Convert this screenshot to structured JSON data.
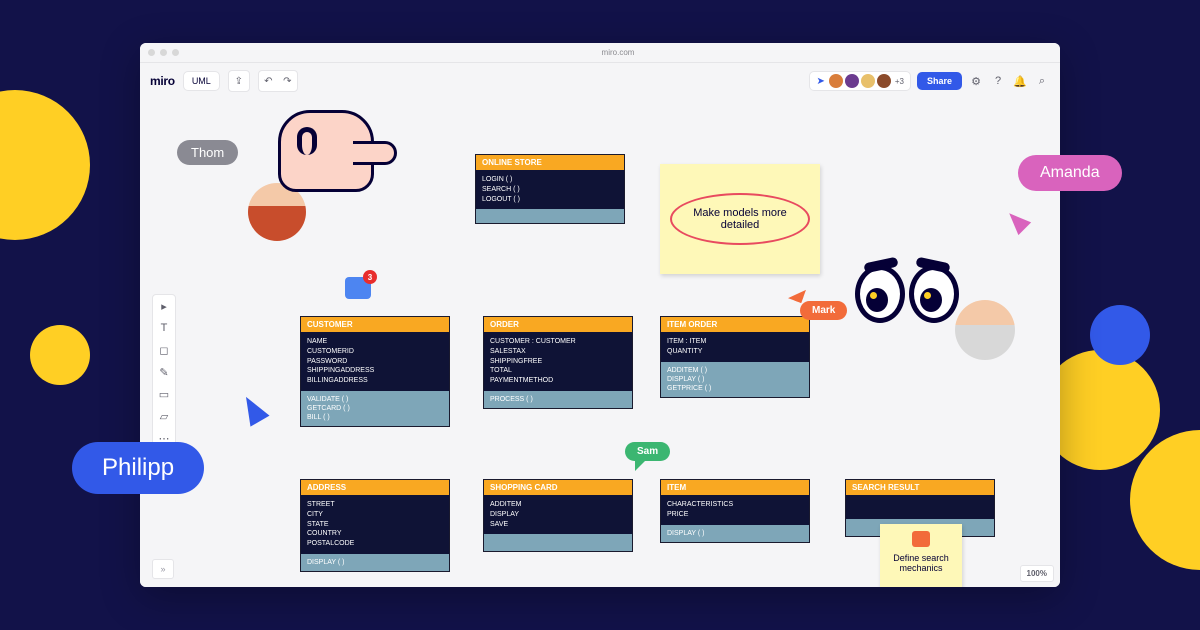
{
  "url": "miro.com",
  "logo": "miro",
  "doc_title": "UML",
  "zoom": "100%",
  "share_label": "Share",
  "presence_extra": "+3",
  "comment_count": "3",
  "cursors": {
    "thom": "Thom",
    "philipp": "Philipp",
    "amanda": "Amanda",
    "mark": "Mark",
    "sam": "Sam"
  },
  "stickies": {
    "models": "Make models more detailed",
    "search": "Define search mechanics"
  },
  "uml": {
    "online_store": {
      "title": "ONLINE STORE",
      "attrs": [
        "LOGIN ( )",
        "SEARCH ( )",
        "LOGOUT ( )"
      ],
      "ops": []
    },
    "customer": {
      "title": "CUSTOMER",
      "attrs": [
        "NAME",
        "CUSTOMERID",
        "PASSWORD",
        "SHIPPINGADDRESS",
        "BILLINGADDRESS"
      ],
      "ops": [
        "VALIDATE ( )",
        "GETCARD ( )",
        "BILL ( )"
      ]
    },
    "order": {
      "title": "ORDER",
      "attrs": [
        "CUSTOMER : CUSTOMER",
        "SALESTAX",
        "SHIPPINGFREE",
        "TOTAL",
        "PAYMENTMETHOD"
      ],
      "ops": [
        "PROCESS ( )"
      ]
    },
    "item_order": {
      "title": "ITEM ORDER",
      "attrs": [
        "ITEM : ITEM",
        "QUANTITY"
      ],
      "ops": [
        "ADDITEM ( )",
        "DISPLAY ( )",
        "GETPRICE ( )"
      ]
    },
    "address": {
      "title": "ADDRESS",
      "attrs": [
        "STREET",
        "CITY",
        "STATE",
        "COUNTRY",
        "POSTALCODE"
      ],
      "ops": [
        "DISPLAY ( )"
      ]
    },
    "shopping": {
      "title": "SHOPPING CARD",
      "attrs": [
        "ADDITEM",
        "DISPLAY",
        "SAVE"
      ],
      "ops": [
        ""
      ]
    },
    "item": {
      "title": "ITEM",
      "attrs": [
        "CHARACTERISTICS",
        "PRICE"
      ],
      "ops": [
        "DISPLAY ( )"
      ]
    },
    "search_result": {
      "title": "SEARCH RESULT",
      "attrs": [
        ""
      ],
      "ops": [
        ""
      ]
    }
  }
}
